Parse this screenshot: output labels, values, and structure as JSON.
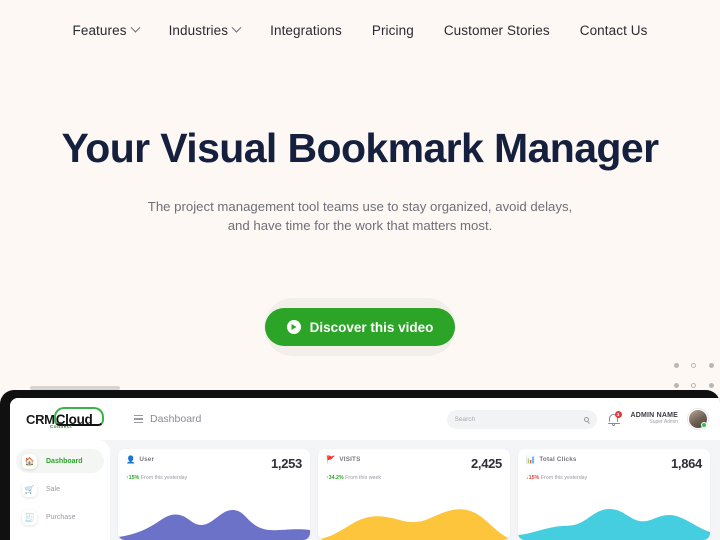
{
  "nav": {
    "items": [
      {
        "label": "Features",
        "has_caret": true
      },
      {
        "label": "Industries",
        "has_caret": true
      },
      {
        "label": "Integrations",
        "has_caret": false
      },
      {
        "label": "Pricing",
        "has_caret": false
      },
      {
        "label": "Customer Stories",
        "has_caret": false
      },
      {
        "label": "Contact Us",
        "has_caret": false
      }
    ]
  },
  "hero": {
    "title": "Your Visual Bookmark Manager",
    "subtitle_line1": "The project management tool teams use to stay organized, avoid delays,",
    "subtitle_line2": "and have time for the work that matters most.",
    "cta_label": "Discover this video",
    "cta_icon": "play-circle-icon",
    "cta_color": "#2ba428"
  },
  "colors": {
    "page_background": "#fdf8f4",
    "heading": "#15203f",
    "accent_green": "#2ba428",
    "laptop_frame": "#101010",
    "dashboard_background": "#f4f5f7"
  },
  "dashboard": {
    "logo": {
      "prefix": "CRM",
      "main": "Cloud",
      "tagline": "Connect"
    },
    "breadcrumb": "Dashboard",
    "menu_icon": "hamburger-icon",
    "search": {
      "placeholder": "Search",
      "value": "",
      "icon": "search-icon"
    },
    "notifications": {
      "icon": "bell-icon",
      "count": "3"
    },
    "user": {
      "name": "ADMIN NAME",
      "role": "Super Admin",
      "avatar": "user-avatar"
    },
    "sidebar": [
      {
        "label": "Dashboard",
        "icon": "🏠",
        "active": true
      },
      {
        "label": "Sale",
        "icon": "🛒",
        "active": false
      },
      {
        "label": "Purchase",
        "icon": "🧾",
        "active": false
      }
    ],
    "cards": [
      {
        "title": "User",
        "icon": "user-icon",
        "glyph": "👤",
        "value": "1,253",
        "delta_arrow": "↑",
        "delta_value": "15%",
        "delta_text": "From this yesterday",
        "direction": "up",
        "chart_color": "#6b72c7"
      },
      {
        "title": "VISITS",
        "icon": "flag-icon",
        "glyph": "🚩",
        "value": "2,425",
        "delta_arrow": "↑",
        "delta_value": "34.2%",
        "delta_text": "From this week",
        "direction": "up",
        "chart_color": "#fcc53c"
      },
      {
        "title": "Total Clicks",
        "icon": "chart-icon",
        "glyph": "📊",
        "value": "1,864",
        "delta_arrow": "↓",
        "delta_value": "15%",
        "delta_text": "From this yesterday",
        "direction": "down",
        "chart_color": "#45cde0"
      }
    ]
  }
}
